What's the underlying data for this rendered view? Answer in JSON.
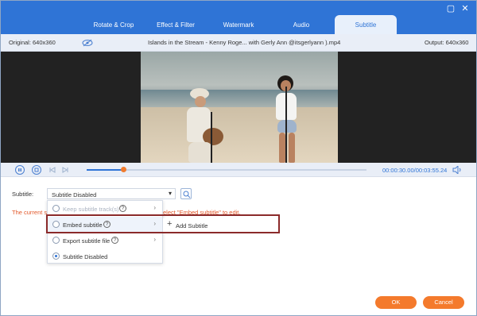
{
  "tabs": [
    {
      "label": "Rotate & Crop"
    },
    {
      "label": "Effect & Filter"
    },
    {
      "label": "Watermark"
    },
    {
      "label": "Audio"
    },
    {
      "label": "Subtitle",
      "active": true
    }
  ],
  "window": {
    "minimize": "▢",
    "close": "✕"
  },
  "info": {
    "original": "Original: 640x360",
    "filename": "Islands in the Stream - Kenny Roge... with Gerly Ann @itsgerlyann ).mp4",
    "output": "Output: 640x360"
  },
  "player": {
    "time": "00:00:30.00/00:03:55.24",
    "progress": 0.13
  },
  "subtitle": {
    "label": "Subtitle:",
    "selected": "Subtitle Disabled",
    "warning_left": "The current s",
    "warning_right": "elect \"Embed subtitle\" to edit.",
    "options": [
      {
        "label": "Keep subtitle track(s)",
        "disabled": true,
        "help": true,
        "arrow": true
      },
      {
        "label": "Embed subtitle",
        "disabled": false,
        "help": true,
        "arrow": true
      },
      {
        "label": "Export subtitle file",
        "disabled": false,
        "help": true,
        "arrow": true
      },
      {
        "label": "Subtitle Disabled",
        "disabled": false,
        "selected": true,
        "help": false,
        "arrow": false
      }
    ],
    "add_subtitle": "Add Subtitle",
    "help_glyph": "?"
  },
  "footer": {
    "ok": "OK",
    "cancel": "Cancel"
  },
  "colors": {
    "accent": "#2f74d6",
    "action": "#f47a2c",
    "highlight": "#8b2a2a"
  }
}
